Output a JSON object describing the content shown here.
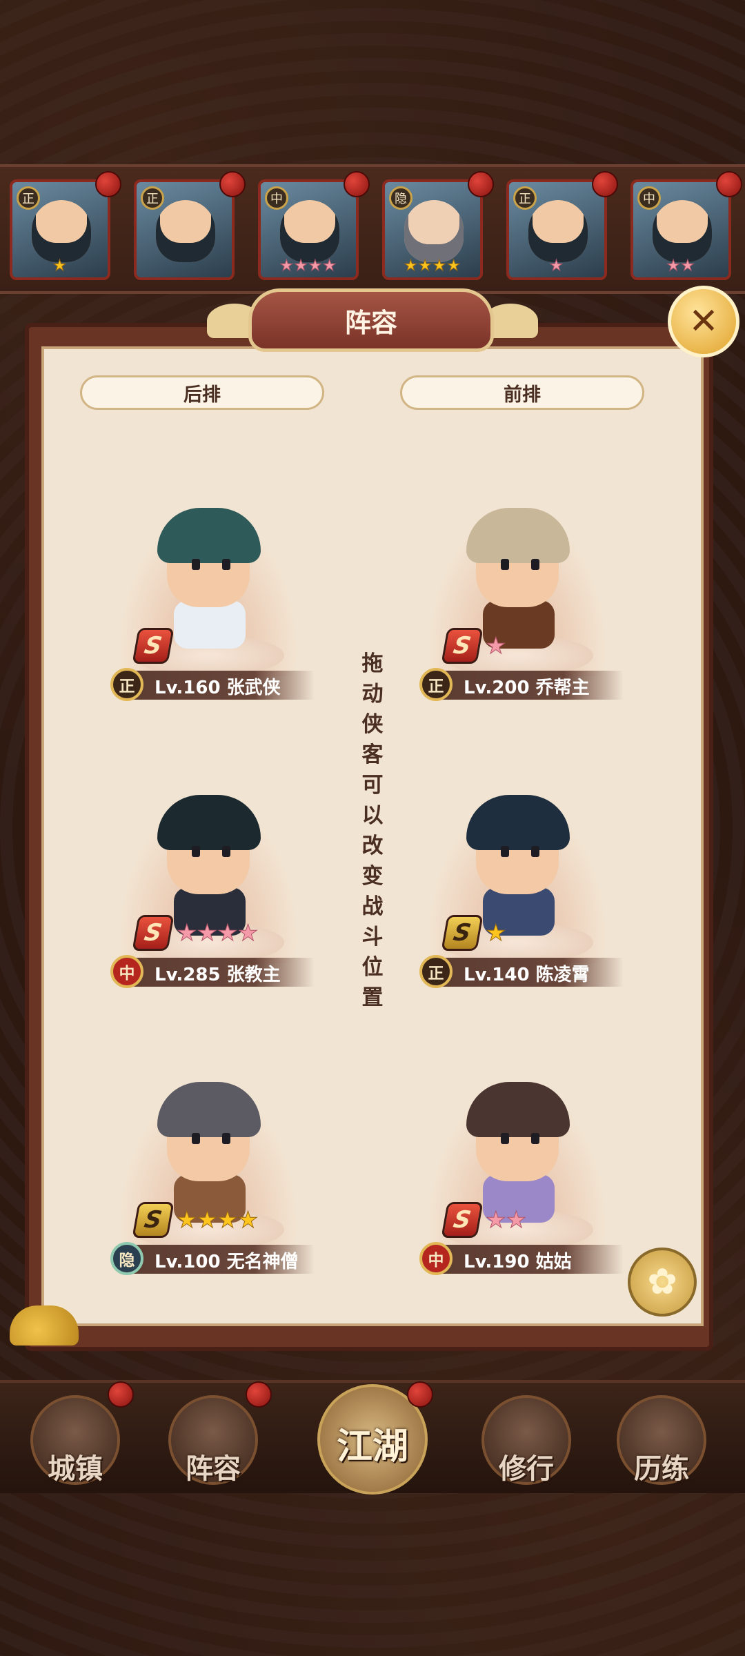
{
  "top_heroes": [
    {
      "faction": "正",
      "stars": "★",
      "star_color": "gold",
      "selected": true
    },
    {
      "faction": "正",
      "stars": "",
      "star_color": "gold",
      "selected": false
    },
    {
      "faction": "中",
      "stars": "★★★★",
      "star_color": "pink",
      "selected": false
    },
    {
      "faction": "隐",
      "stars": "★★★★",
      "star_color": "gold",
      "selected": false
    },
    {
      "faction": "正",
      "stars": "★",
      "star_color": "pink",
      "selected": false
    },
    {
      "faction": "中",
      "stars": "★★",
      "star_color": "pink",
      "selected": false
    }
  ],
  "panel": {
    "title": "阵容",
    "close_icon": "✕",
    "back_row_label": "后排",
    "front_row_label": "前排",
    "hint": "拖动侠客可以改变战斗位置"
  },
  "heroes": [
    {
      "grade": "S",
      "grade_style": "red",
      "stars": "",
      "star_color": "pink",
      "faction": "正",
      "faction_style": "zheng",
      "name": "Lv.160 张武侠",
      "hair": "#2f5a5a",
      "body": "#e8eef4"
    },
    {
      "grade": "S",
      "grade_style": "red",
      "stars": "★",
      "star_color": "pink",
      "faction": "正",
      "faction_style": "zheng",
      "name": "Lv.200 乔帮主",
      "hair": "#c9b79a",
      "body": "#6a3a22"
    },
    {
      "grade": "S",
      "grade_style": "red",
      "stars": "★★★★",
      "star_color": "pink",
      "faction": "中",
      "faction_style": "zhong",
      "name": "Lv.285 张教主",
      "hair": "#1c2a30",
      "body": "#2a2e3a"
    },
    {
      "grade": "S",
      "grade_style": "gold",
      "stars": "★",
      "star_color": "gold",
      "faction": "正",
      "faction_style": "zheng",
      "name": "Lv.140 陈凌霄",
      "hair": "#1e2e3e",
      "body": "#3a4a70"
    },
    {
      "grade": "S",
      "grade_style": "gold",
      "stars": "★★★★",
      "star_color": "gold",
      "faction": "隐",
      "faction_style": "yin",
      "name": "Lv.100 无名神僧",
      "hair": "#5c5a62",
      "body": "#8a5a3a"
    },
    {
      "grade": "S",
      "grade_style": "red",
      "stars": "★★",
      "star_color": "pink",
      "faction": "中",
      "faction_style": "zhong",
      "name": "Lv.190 姑姑",
      "hair": "#4a3530",
      "body": "#9a88c8"
    }
  ],
  "fan_icon": "✿",
  "bottom_nav": [
    {
      "label": "城镇"
    },
    {
      "label": "阵容"
    },
    {
      "label": "江湖"
    },
    {
      "label": "修行"
    },
    {
      "label": "历练"
    }
  ]
}
